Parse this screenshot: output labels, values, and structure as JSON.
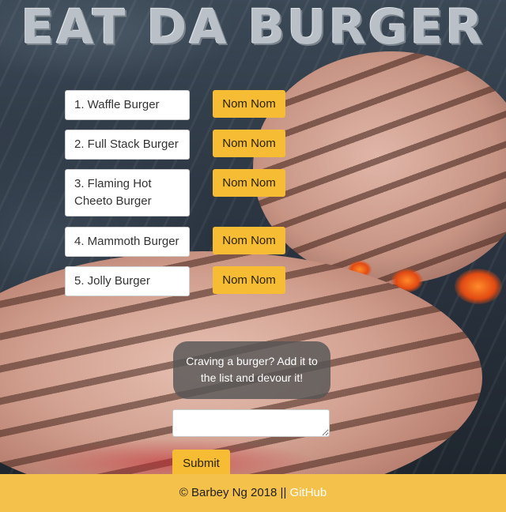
{
  "header": {
    "title": "EAT DA BURGER"
  },
  "burgers": [
    {
      "label": "1. Waffle Burger",
      "button": "Nom Nom"
    },
    {
      "label": "2. Full Stack Burger",
      "button": "Nom Nom"
    },
    {
      "label": "3. Flaming Hot Cheeto Burger",
      "button": "Nom Nom"
    },
    {
      "label": "4. Mammoth Burger",
      "button": "Nom Nom"
    },
    {
      "label": "5. Jolly Burger",
      "button": "Nom Nom"
    }
  ],
  "form": {
    "prompt": "Craving a burger? Add it to the list and devour it!",
    "input_value": "",
    "submit_label": "Submit"
  },
  "footer": {
    "text": "© Barbey Ng 2018 || ",
    "link_label": "GitHub"
  },
  "colors": {
    "accent": "#f6bc34",
    "footer_bg": "#f4c14a",
    "bubble_bg": "#555555"
  }
}
